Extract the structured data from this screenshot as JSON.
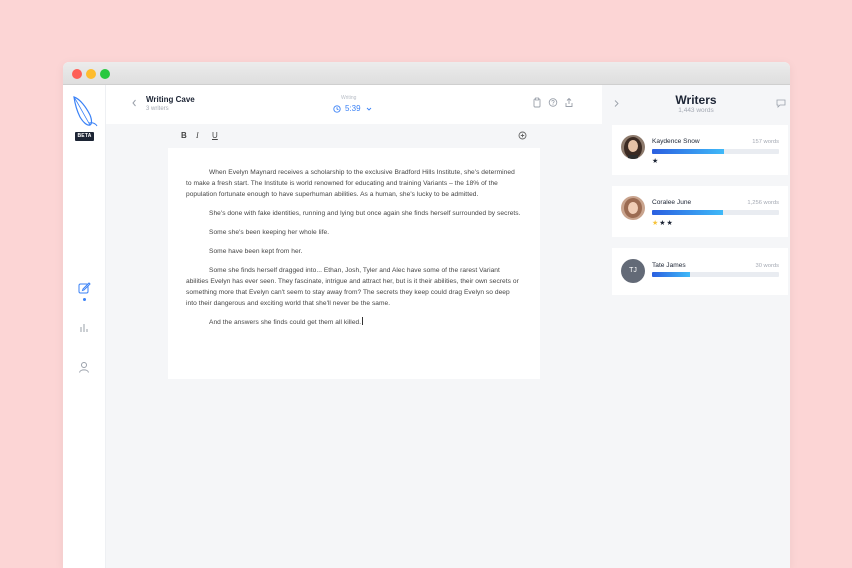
{
  "document": {
    "title": "Writing Cave",
    "subtitle": "3 writers",
    "timer_label": "Writing",
    "timer_value": "5:39",
    "badge": "BETA",
    "paragraphs": [
      "When Evelyn Maynard receives a scholarship to the exclusive Bradford Hills Institute, she's determined to make a fresh start. The Institute is world renowned for educating and training Variants – the 18% of the population fortunate enough to have superhuman abilities. As a human, she's lucky to be admitted.",
      "She's done with fake identities, running and lying but once again she finds herself surrounded by secrets.",
      "Some she's been keeping her whole life.",
      "Some have been kept from her.",
      "Some she finds herself dragged into... Ethan, Josh, Tyler and Alec have some of the rarest Variant abilities Evelyn has ever seen. They fascinate, intrigue and attract her, but is it their abilities, their own secrets or something more that Evelyn can't seem to stay away from? The secrets they keep could drag Evelyn so deep into their dangerous and exciting world that she'll never be the same.",
      "And the answers she finds could get them all killed."
    ]
  },
  "toolbar": {
    "bold": "B",
    "italic": "I",
    "underline": "U"
  },
  "panel": {
    "title": "Writers",
    "subtitle": "1,443 words",
    "writers": [
      {
        "name": "Kaydence Snow",
        "words": "157 words",
        "progress": 0.57,
        "stars": "★",
        "gold_stars": ""
      },
      {
        "name": "Coralee June",
        "words": "1,256 words",
        "progress": 0.56,
        "stars": "★★",
        "gold_stars": "★"
      },
      {
        "name": "Tate James",
        "words": "30 words",
        "progress": 0.3,
        "initials": "TJ",
        "stars": "",
        "gold_stars": ""
      }
    ]
  },
  "colors": {
    "accent": "#3b82f6",
    "background": "#fcd5d5",
    "star_gold": "#f6c33b"
  }
}
